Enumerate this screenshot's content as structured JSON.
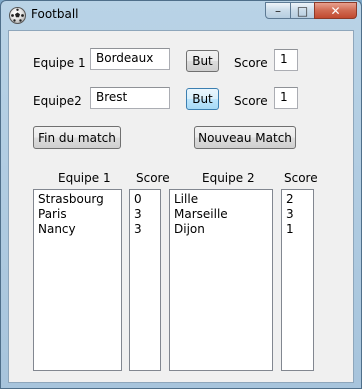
{
  "window": {
    "title": "Football",
    "controls": {
      "minimize": "–",
      "maximize": "□",
      "close": "✕"
    }
  },
  "form": {
    "team1_label": "Equipe 1",
    "team1_value": "Bordeaux",
    "team2_label": "Equipe2",
    "team2_value": "Brest",
    "goal_button": "But",
    "score_label": "Score",
    "score1_value": "1",
    "score2_value": "1",
    "end_match_button": "Fin du match",
    "new_match_button": "Nouveau Match"
  },
  "results": {
    "headers": {
      "team1": "Equipe 1",
      "score1": "Score",
      "team2": "Equipe 2",
      "score2": "Score"
    },
    "team1": [
      "Strasbourg",
      "Paris",
      "Nancy"
    ],
    "score1": [
      "0",
      "3",
      "3"
    ],
    "team2": [
      "Lille",
      "Marseille",
      "Dijon"
    ],
    "score2": [
      "2",
      "3",
      "1"
    ]
  },
  "icons": {
    "app": "football-icon"
  }
}
